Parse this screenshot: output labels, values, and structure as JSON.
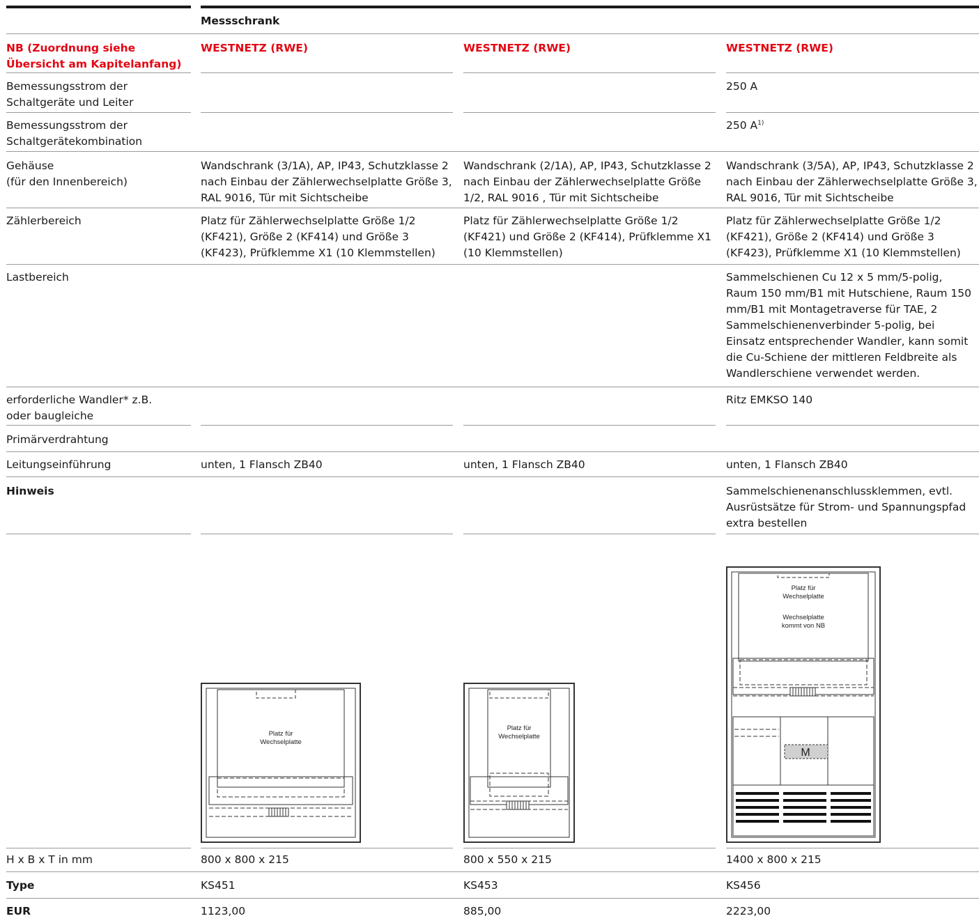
{
  "header": {
    "title": "Messschrank"
  },
  "rows": [
    {
      "label": "NB (Zuordnung siehe\nÜbersicht am Kapitelanfang)",
      "c1": "WESTNETZ (RWE)",
      "c2": "WESTNETZ (RWE)",
      "c3": "WESTNETZ (RWE)"
    },
    {
      "label": "Bemessungsstrom der\nSchaltgeräte und Leiter",
      "c1": "",
      "c2": "",
      "c3": "250 A"
    },
    {
      "label": "Bemessungsstrom der\nSchaltgerätekombination",
      "c1": "",
      "c2": "",
      "c3": "250 A",
      "c3_sup": "1)"
    },
    {
      "label": "Gehäuse\n(für den Innenbereich)",
      "c1": "Wandschrank (3/1A), AP, IP43, Schutzklasse 2\nnach Einbau der Zählerwechselplatte Größe 3,\nRAL 9016, Tür mit Sichtscheibe",
      "c2": "Wandschrank (2/1A), AP, IP43, Schutzklasse 2\nnach Einbau der Zählerwechselplatte Größe\n1/2, RAL 9016 , Tür mit Sichtscheibe",
      "c3": "Wandschrank (3/5A), AP, IP43, Schutzklasse 2\nnach Einbau der Zählerwechselplatte Größe 3,\nRAL 9016, Tür mit Sichtscheibe"
    },
    {
      "label": "Zählerbereich",
      "c1": "Platz für Zählerwechselplatte Größe 1/2\n(KF421), Größe 2 (KF414) und Größe 3\n(KF423), Prüfklemme X1 (10 Klemmstellen)",
      "c2": "Platz für Zählerwechselplatte Größe 1/2\n(KF421) und Größe 2 (KF414), Prüfklemme X1\n(10 Klemmstellen)",
      "c3": "Platz für Zählerwechselplatte Größe 1/2\n(KF421), Größe 2 (KF414) und Größe 3\n(KF423), Prüfklemme X1 (10 Klemmstellen)"
    },
    {
      "label": "Lastbereich",
      "c1": "",
      "c2": "",
      "c3": "Sammelschienen Cu 12 x 5 mm/5-polig,\nRaum 150 mm/B1 mit Hutschiene, Raum 150\nmm/B1 mit Montagetraverse für TAE, 2\nSammelschienenverbinder 5-polig, bei\nEinsatz entsprechender Wandler, kann somit\ndie Cu-Schiene der mittleren Feldbreite als\nWandlerschiene verwendet werden."
    },
    {
      "label": "erforderliche Wandler* z.B.\noder baugleiche",
      "c1": "",
      "c2": "",
      "c3": "Ritz EMKSO 140"
    },
    {
      "label": "Primärverdrahtung",
      "c1": "",
      "c2": "",
      "c3": ""
    },
    {
      "label": "Leitungseinführung",
      "c1": "unten, 1 Flansch ZB40",
      "c2": "unten, 1 Flansch ZB40",
      "c3": "unten, 1 Flansch ZB40"
    },
    {
      "label": "Hinweis",
      "c1": "",
      "c2": "",
      "c3": "Sammelschienenanschlussklemmen, evtl.\nAusrüstsätze für Strom- und Spannungspfad\nextra bestellen"
    }
  ],
  "drawings": {
    "d1": {
      "label": "Platz für\nWechselplatte",
      "l1": "Platz für",
      "l2": "Wechselplatte"
    },
    "d2": {
      "l1": "Platz für",
      "l2": "Wechselplatte"
    },
    "d3": {
      "l1": "Platz für",
      "l2": "Wechselplatte",
      "l3": "Wechselplatte",
      "l4": "kommt von NB",
      "m": "M"
    }
  },
  "bottom": [
    {
      "label": "H x B x T in mm",
      "c1": "800 x 800 x 215",
      "c2": "800 x 550 x 215",
      "c3": "1400 x 800 x 215"
    },
    {
      "label": "Type",
      "c1": "KS451",
      "c2": "KS453",
      "c3": "KS456"
    },
    {
      "label": "EUR",
      "c1": "1123,00",
      "c2": "885,00",
      "c3": "2223,00"
    }
  ]
}
